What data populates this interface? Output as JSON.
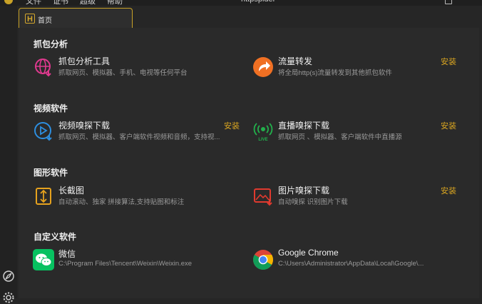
{
  "titlebar": {
    "menu": [
      "文件",
      "证书",
      "超级",
      "帮助"
    ],
    "title": "httpspider"
  },
  "tab": {
    "label": "首页"
  },
  "sections": [
    {
      "title": "抓包分析",
      "items": [
        {
          "name": "抓包分析工具",
          "desc": "抓取网页、模拟器、手机、电视等任何平台",
          "install": ""
        },
        {
          "name": "流量转发",
          "desc": "将全局http(s)流量转发到其他抓包软件",
          "install": "安装"
        }
      ]
    },
    {
      "title": "视频软件",
      "items": [
        {
          "name": "视频嗅探下载",
          "desc": "抓取网页、模拟器、客户端软件视频和音频，支持视...",
          "install": "安装"
        },
        {
          "name": "直播嗅探下载",
          "desc": "抓取网页 、模拟器、客户端软件中直播源",
          "install": "安装"
        }
      ]
    },
    {
      "title": "图形软件",
      "items": [
        {
          "name": "长截图",
          "desc": "自动滚动、独家 拼接算法,支持贴图和标注",
          "install": ""
        },
        {
          "name": "图片嗅探下载",
          "desc": "自动嗅探 识别图片下载",
          "install": "安装"
        }
      ]
    },
    {
      "title": "自定义软件",
      "items": [
        {
          "name": "微信",
          "desc": "C:\\Program Files\\Tencent\\Weixin\\Weixin.exe",
          "install": ""
        },
        {
          "name": "Google Chrome",
          "desc": "C:\\Users\\Administrator\\AppData\\Local\\Google\\...",
          "install": ""
        }
      ]
    }
  ],
  "icons": {
    "packet": "packet-analysis-icon",
    "forward": "forward-arrow-icon",
    "video": "play-download-icon",
    "live": "live-broadcast-icon",
    "screenshot": "long-screenshot-icon",
    "image": "image-download-icon",
    "wechat": "wechat-icon",
    "chrome": "chrome-icon"
  },
  "colors": {
    "accent": "#c9a227",
    "install": "#d9a521",
    "background": "#2a2a2a"
  }
}
